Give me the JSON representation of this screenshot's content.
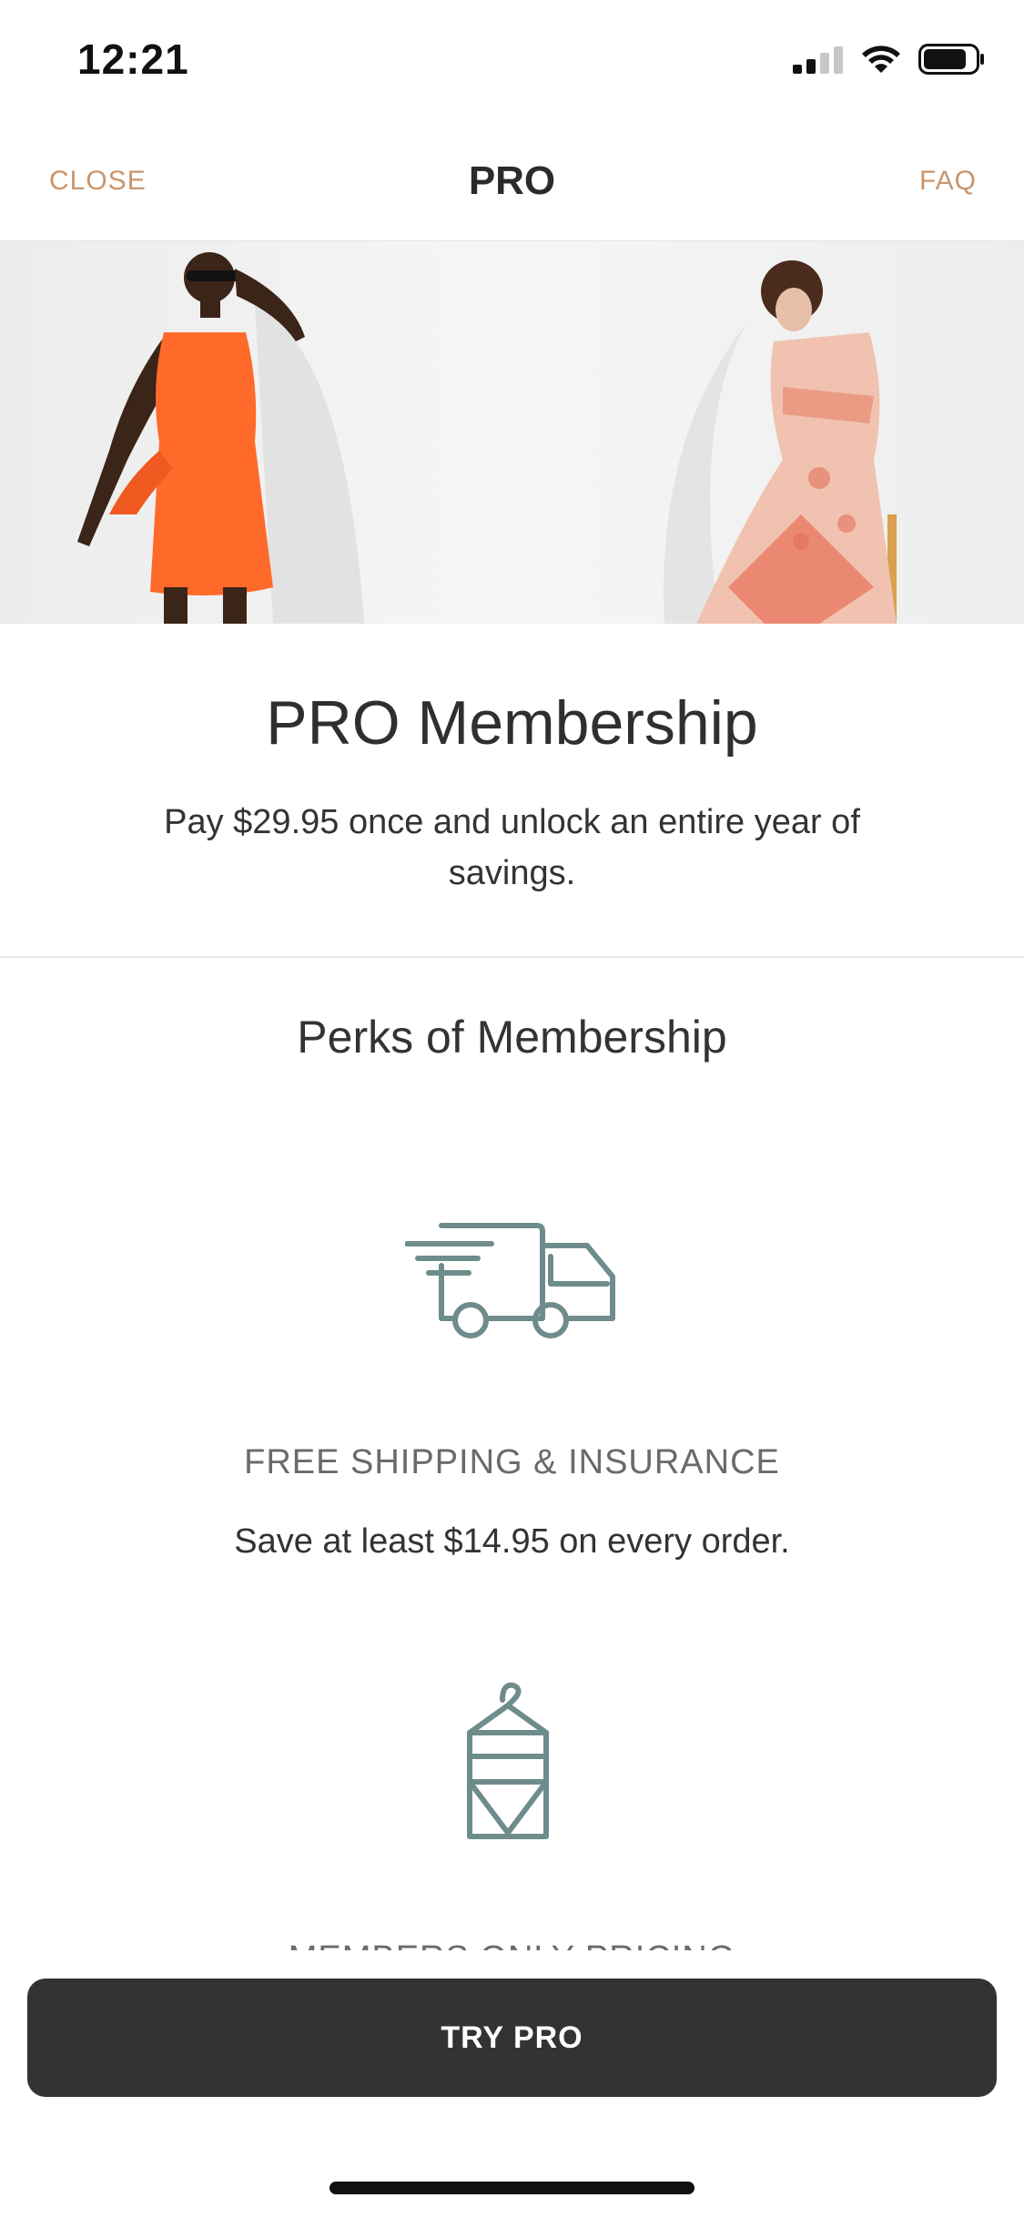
{
  "status_bar": {
    "time": "12:21"
  },
  "nav": {
    "close": "CLOSE",
    "title": "PRO",
    "faq": "FAQ",
    "accent_color": "#c8956b"
  },
  "intro": {
    "title": "PRO Membership",
    "subtitle": "Pay $29.95 once and unlock an entire year of savings."
  },
  "perks": {
    "title": "Perks of Membership",
    "items": [
      {
        "icon": "delivery-truck-icon",
        "heading": "FREE SHIPPING & INSURANCE",
        "description": "Save at least $14.95 on every order."
      },
      {
        "icon": "garment-bag-icon",
        "heading": "MEMBERS ONLY PRICING"
      }
    ]
  },
  "cta": {
    "label": "TRY PRO"
  },
  "colors": {
    "icon": "#6f8c8c",
    "button": "#333333"
  }
}
